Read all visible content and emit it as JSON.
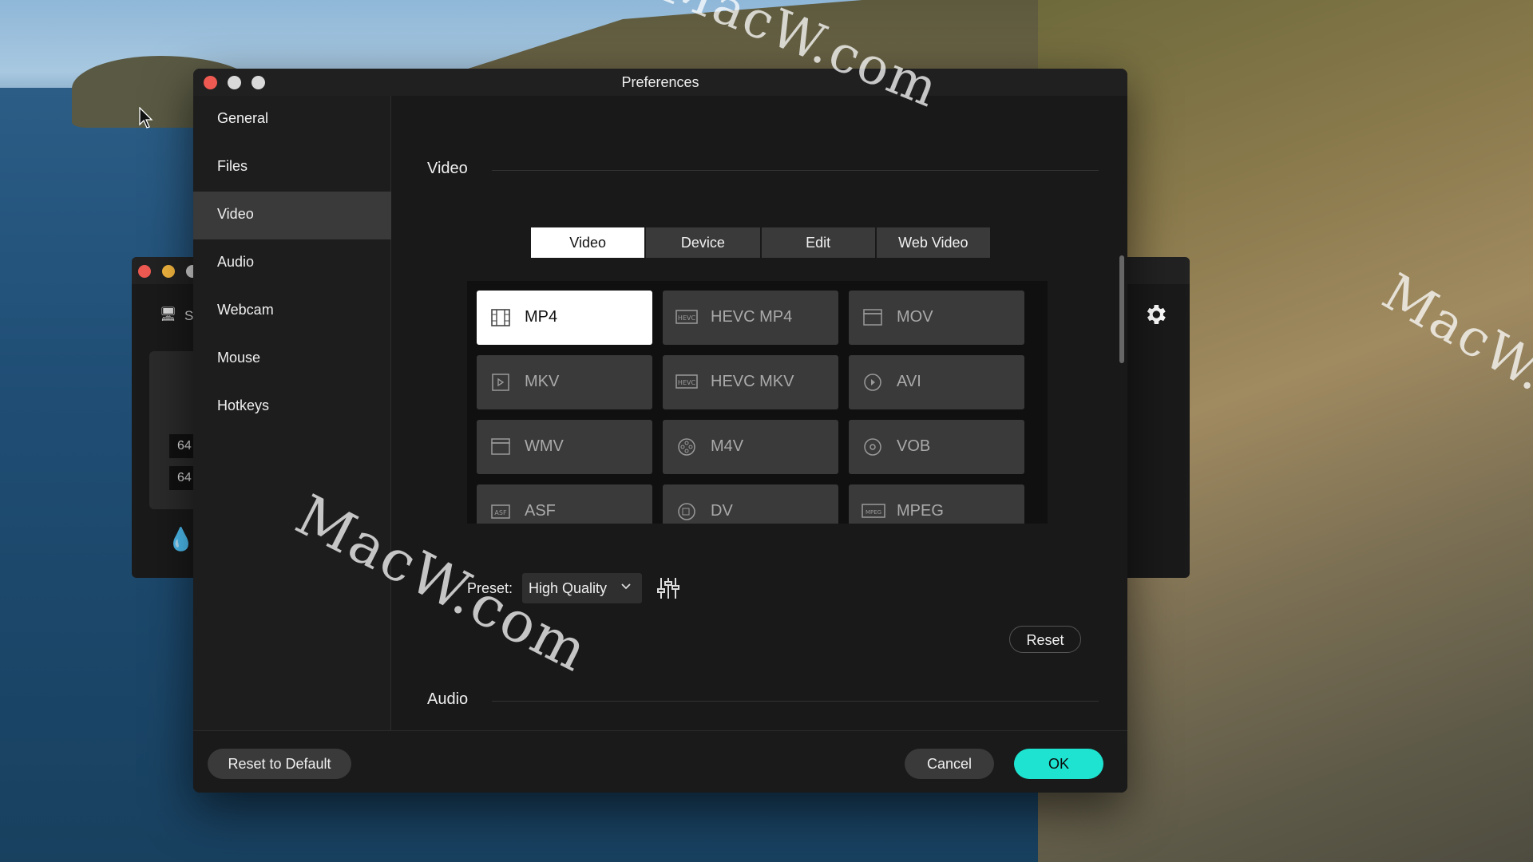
{
  "window": {
    "title": "Preferences"
  },
  "sidebar": {
    "items": [
      {
        "label": "General"
      },
      {
        "label": "Files"
      },
      {
        "label": "Video",
        "active": true
      },
      {
        "label": "Audio"
      },
      {
        "label": "Webcam"
      },
      {
        "label": "Mouse"
      },
      {
        "label": "Hotkeys"
      }
    ]
  },
  "video_section": {
    "title": "Video",
    "tabs": [
      {
        "label": "Video",
        "active": true
      },
      {
        "label": "Device"
      },
      {
        "label": "Edit"
      },
      {
        "label": "Web Video"
      }
    ],
    "formats": [
      {
        "label": "MP4",
        "icon": "film-icon",
        "selected": true
      },
      {
        "label": "HEVC MP4",
        "icon": "hevc-icon"
      },
      {
        "label": "MOV",
        "icon": "clapper-icon"
      },
      {
        "label": "MKV",
        "icon": "video-file-icon"
      },
      {
        "label": "HEVC MKV",
        "icon": "hevc-icon"
      },
      {
        "label": "AVI",
        "icon": "play-circle-icon"
      },
      {
        "label": "WMV",
        "icon": "clapper-icon"
      },
      {
        "label": "M4V",
        "icon": "reel-icon"
      },
      {
        "label": "VOB",
        "icon": "disc-icon"
      },
      {
        "label": "ASF",
        "icon": "asf-icon"
      },
      {
        "label": "DV",
        "icon": "dv-icon"
      },
      {
        "label": "MPEG",
        "icon": "mpeg-icon"
      }
    ],
    "preset_label": "Preset:",
    "preset_value": "High Quality",
    "reset_label": "Reset"
  },
  "audio_section": {
    "title": "Audio"
  },
  "footer": {
    "reset_default_label": "Reset to Default",
    "cancel_label": "Cancel",
    "ok_label": "OK"
  },
  "background_window": {
    "label_fragment": "S",
    "values": [
      "64",
      "64"
    ]
  },
  "watermarks": [
    "MacW.com",
    "MacW.c",
    "MacW.com"
  ],
  "colors": {
    "accent": "#1de3d0",
    "close": "#ee5a52",
    "bg": "#191919"
  }
}
